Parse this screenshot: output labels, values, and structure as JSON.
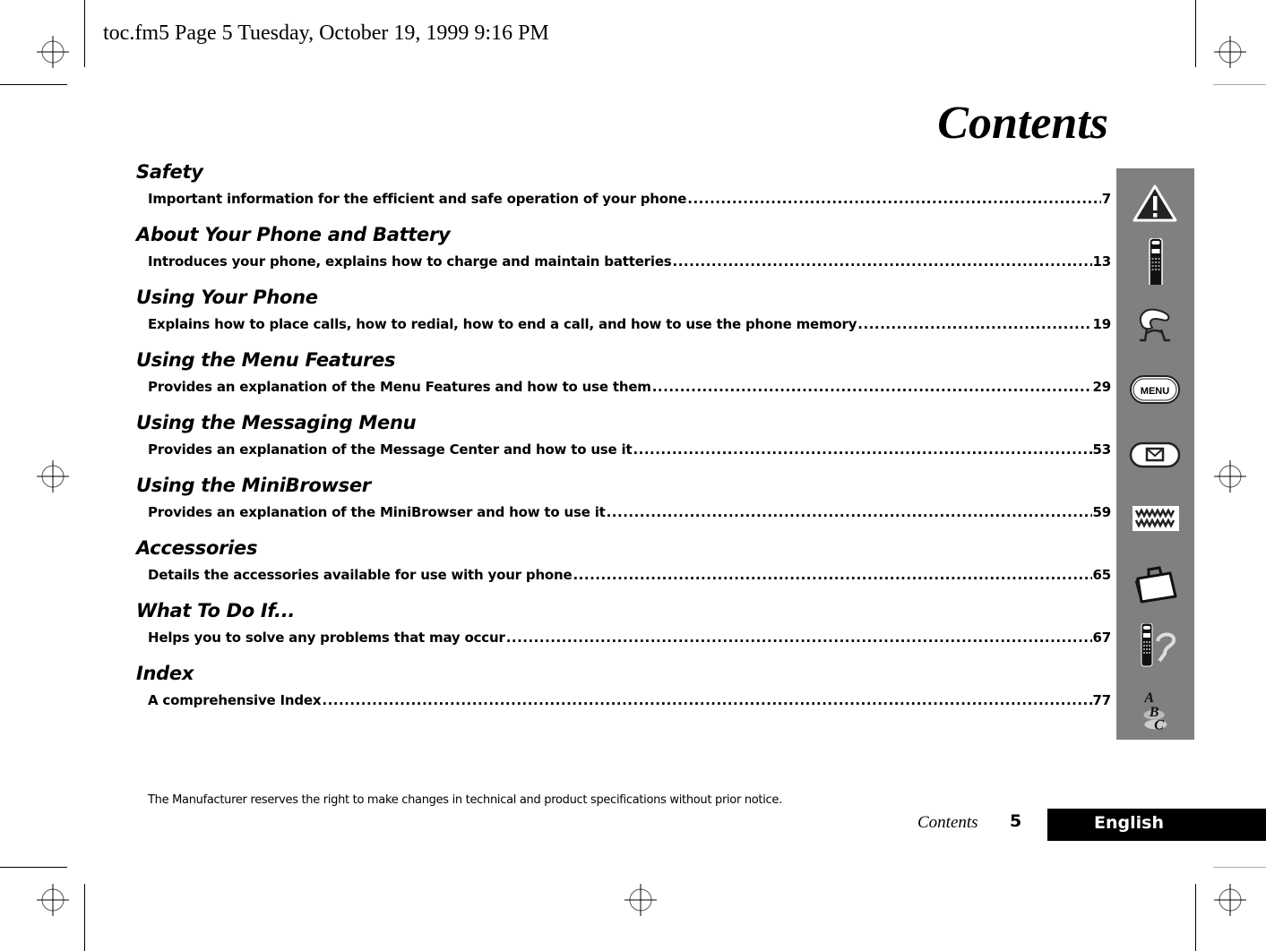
{
  "header": {
    "print_slug": "toc.fm5  Page 5  Tuesday, October 19, 1999  9:16 PM"
  },
  "title": "Contents",
  "sections": [
    {
      "title": "Safety",
      "description": "Important information for the efficient and safe operation of your phone",
      "page": "7",
      "icon": "warning-icon"
    },
    {
      "title": "About Your Phone and Battery",
      "description": "Introduces your phone, explains how to charge and maintain batteries",
      "page": "13",
      "icon": "mobile-phone-icon"
    },
    {
      "title": "Using Your Phone",
      "description": "Explains how to place calls, how to redial, how to end a call, and how to use the phone memory",
      "page": "19",
      "icon": "telephone-handset-icon"
    },
    {
      "title": "Using the Menu Features",
      "description": "Provides an explanation of the Menu Features and how to use them",
      "page": "29",
      "icon": "menu-button-icon"
    },
    {
      "title": "Using the Messaging Menu",
      "description": "Provides an explanation of the Message Center and how to use it",
      "page": "53",
      "icon": "envelope-button-icon"
    },
    {
      "title": "Using the MiniBrowser",
      "description": "Provides an explanation of the MiniBrowser and how to use it",
      "page": "59",
      "icon": "www-icon"
    },
    {
      "title": "Accessories",
      "description": "Details the accessories available for use with your phone",
      "page": "65",
      "icon": "briefcase-icon"
    },
    {
      "title": "What To Do If...",
      "description": "Helps you to solve any problems that may occur",
      "page": "67",
      "icon": "phone-question-icon"
    },
    {
      "title": "Index",
      "description": "A comprehensive Index",
      "page": "77",
      "icon": "abc-icon"
    }
  ],
  "sidebar": {
    "menu_icon_label": "MENU",
    "www_icon_label": "WWW",
    "abc_letters": [
      "A",
      "B",
      "C"
    ]
  },
  "footer": {
    "disclaimer": "The Manufacturer reserves the right to make changes in technical and product specifications without prior notice.",
    "running_title": "Contents",
    "page_number": "5",
    "language": "English"
  },
  "colors": {
    "sidebar_bg": "#808080",
    "language_bar_bg": "#000000",
    "language_bar_text": "#ffffff"
  }
}
